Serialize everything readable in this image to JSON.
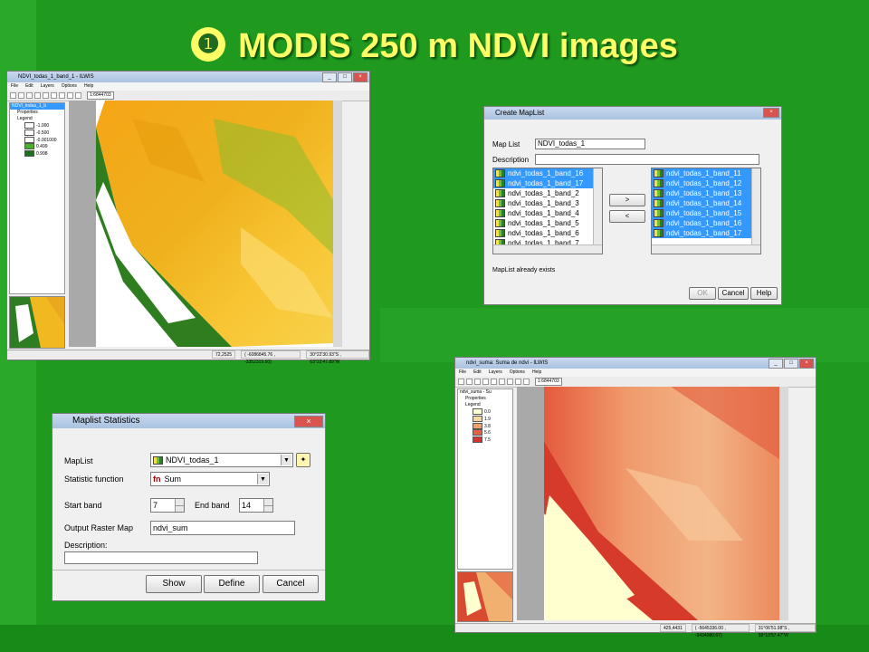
{
  "slide": {
    "title_number": "❶",
    "title": "MODIS 250 m NDVI images"
  },
  "colors": {
    "background": "#1f9a1f",
    "title": "#ffff66",
    "selection": "#3399ff"
  },
  "win1": {
    "title": "NDVI_todas_1_band_1 - ILWIS",
    "menu": [
      "File",
      "Edit",
      "Layers",
      "Options",
      "Help"
    ],
    "coord_field": "1:6844703",
    "tree": {
      "root": "NDVI_todas_1_b",
      "properties": "Properties",
      "legend": "Legend",
      "legend_items": [
        {
          "label": "-1.000",
          "color": "#ffffff"
        },
        {
          "label": "-0.500",
          "color": "#ffffff"
        },
        {
          "label": "-0.001000",
          "color": "#ffffff"
        },
        {
          "label": "0.499",
          "color": "#4caf2a"
        },
        {
          "label": "0.998",
          "color": "#1e6e1e"
        }
      ]
    },
    "status": [
      "72,2525",
      "( -6086845.76 , -3352319.60)",
      "30°22'30.93\"S , 63°22'47.89\"W"
    ]
  },
  "win2": {
    "title": "Create MapList",
    "maplist_label": "Map List",
    "maplist_value": "NDVI_todas_1",
    "description_label": "Description",
    "left_list": [
      "ndvi_todas_1_band_16",
      "ndvi_todas_1_band_17",
      "ndvi_todas_1_band_2",
      "ndvi_todas_1_band_3",
      "ndvi_todas_1_band_4",
      "ndvi_todas_1_band_5",
      "ndvi_todas_1_band_6",
      "ndvi_todas_1_band_7"
    ],
    "right_list": [
      "ndvi_todas_1_band_11",
      "ndvi_todas_1_band_12",
      "ndvi_todas_1_band_13",
      "ndvi_todas_1_band_14",
      "ndvi_todas_1_band_15",
      "ndvi_todas_1_band_16",
      "ndvi_todas_1_band_17"
    ],
    "add_label": ">",
    "remove_label": "<",
    "message": "MapList already exists",
    "ok_label": "OK",
    "cancel_label": "Cancel",
    "help_label": "Help"
  },
  "win3": {
    "title": "Maplist Statistics",
    "maplist_label": "MapList",
    "maplist_value": "NDVI_todas_1",
    "statistic_label": "Statistic function",
    "statistic_icon": "fn",
    "statistic_value": "Sum",
    "start_band_label": "Start band",
    "start_band_value": "7",
    "end_band_label": "End band",
    "end_band_value": "14",
    "output_label": "Output Raster Map",
    "output_value": "ndvi_sum",
    "description_label": "Description:",
    "show_label": "Show",
    "define_label": "Define",
    "cancel_label": "Cancel"
  },
  "win4": {
    "title": "ndvi_suma: Suma de ndvi - ILWIS",
    "menu": [
      "File",
      "Edit",
      "Layers",
      "Options",
      "Help"
    ],
    "coord_field": "1:6844703",
    "tree": {
      "root": "ndvi_suma - Su",
      "properties": "Properties",
      "legend": "Legend",
      "legend_items": [
        {
          "label": "0.0",
          "color": "#ffffd0"
        },
        {
          "label": "1.9",
          "color": "#f8d8a0"
        },
        {
          "label": "3.8",
          "color": "#f2a070"
        },
        {
          "label": "5.6",
          "color": "#e86048"
        },
        {
          "label": "7.5",
          "color": "#d83030"
        }
      ]
    },
    "status": [
      "425,4431",
      "( -5645336.00 , -3434080.67)",
      "31°06'51.98\"S , 59°13'57.47\"W"
    ]
  }
}
